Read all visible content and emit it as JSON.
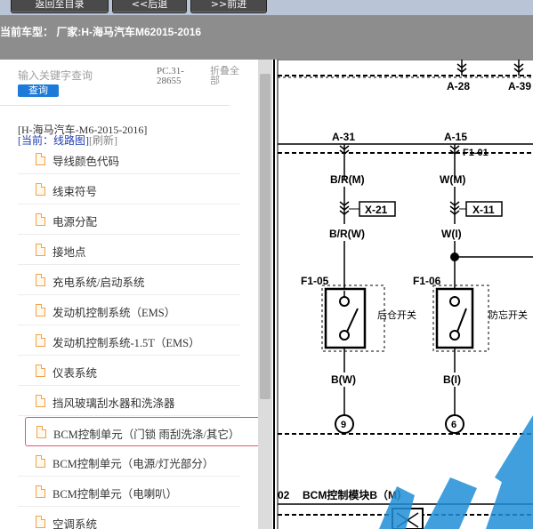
{
  "nav": {
    "back_label": "返回至目录",
    "prev_label": "<<后退",
    "next_label": ">>前进"
  },
  "vehicle": {
    "label": "当前车型： 厂家:H-海马汽车M62015-2016"
  },
  "search": {
    "placeholder": "输入关键字查询",
    "button_label": "查询"
  },
  "page_code": "PC.31-28655",
  "collapse_label": "折叠全部",
  "tree": {
    "root": "[H-海马汽车-M6-2015-2016]",
    "current": "[当前：线路图]",
    "refresh": "[刷新]",
    "items": [
      {
        "label": "导线颜色代码"
      },
      {
        "label": "线束符号"
      },
      {
        "label": "电源分配"
      },
      {
        "label": "接地点"
      },
      {
        "label": "充电系统/启动系统"
      },
      {
        "label": "发动机控制系统（EMS）"
      },
      {
        "label": "发动机控制系统-1.5T（EMS）"
      },
      {
        "label": "仪表系统"
      },
      {
        "label": "挡风玻璃刮水器和洗涤器"
      },
      {
        "label": "BCM控制单元（门锁 雨刮洗涤/其它）",
        "selected": true
      },
      {
        "label": "BCM控制单元（电源/灯光部分）"
      },
      {
        "label": "BCM控制单元（电喇叭）"
      },
      {
        "label": "空调系统"
      }
    ]
  },
  "diagram": {
    "connectors_top": [
      "A-28",
      "A-39"
    ],
    "connectors_mid": [
      "A-31",
      "A-15"
    ],
    "pin_f101": "F1-01",
    "wire_left_top": "B/R(M)",
    "wire_right_top": "W(M)",
    "conn_left": "X-21",
    "conn_right": "X-11",
    "wire_left_mid": "B/R(W)",
    "wire_right_mid": "W(I)",
    "switch_left_pin": "F1-05",
    "switch_right_pin": "F1-06",
    "switch_left_name": "后仓开关",
    "switch_right_name": "防忘开关",
    "wire_left_bot": "B(W)",
    "wire_right_bot": "B(I)",
    "pin_left": "9",
    "pin_right": "6",
    "module_num": "02",
    "module_label": "BCM控制模块B（M）",
    "colors": {
      "line": "#000000",
      "watermark": "#1f8fd6"
    }
  }
}
